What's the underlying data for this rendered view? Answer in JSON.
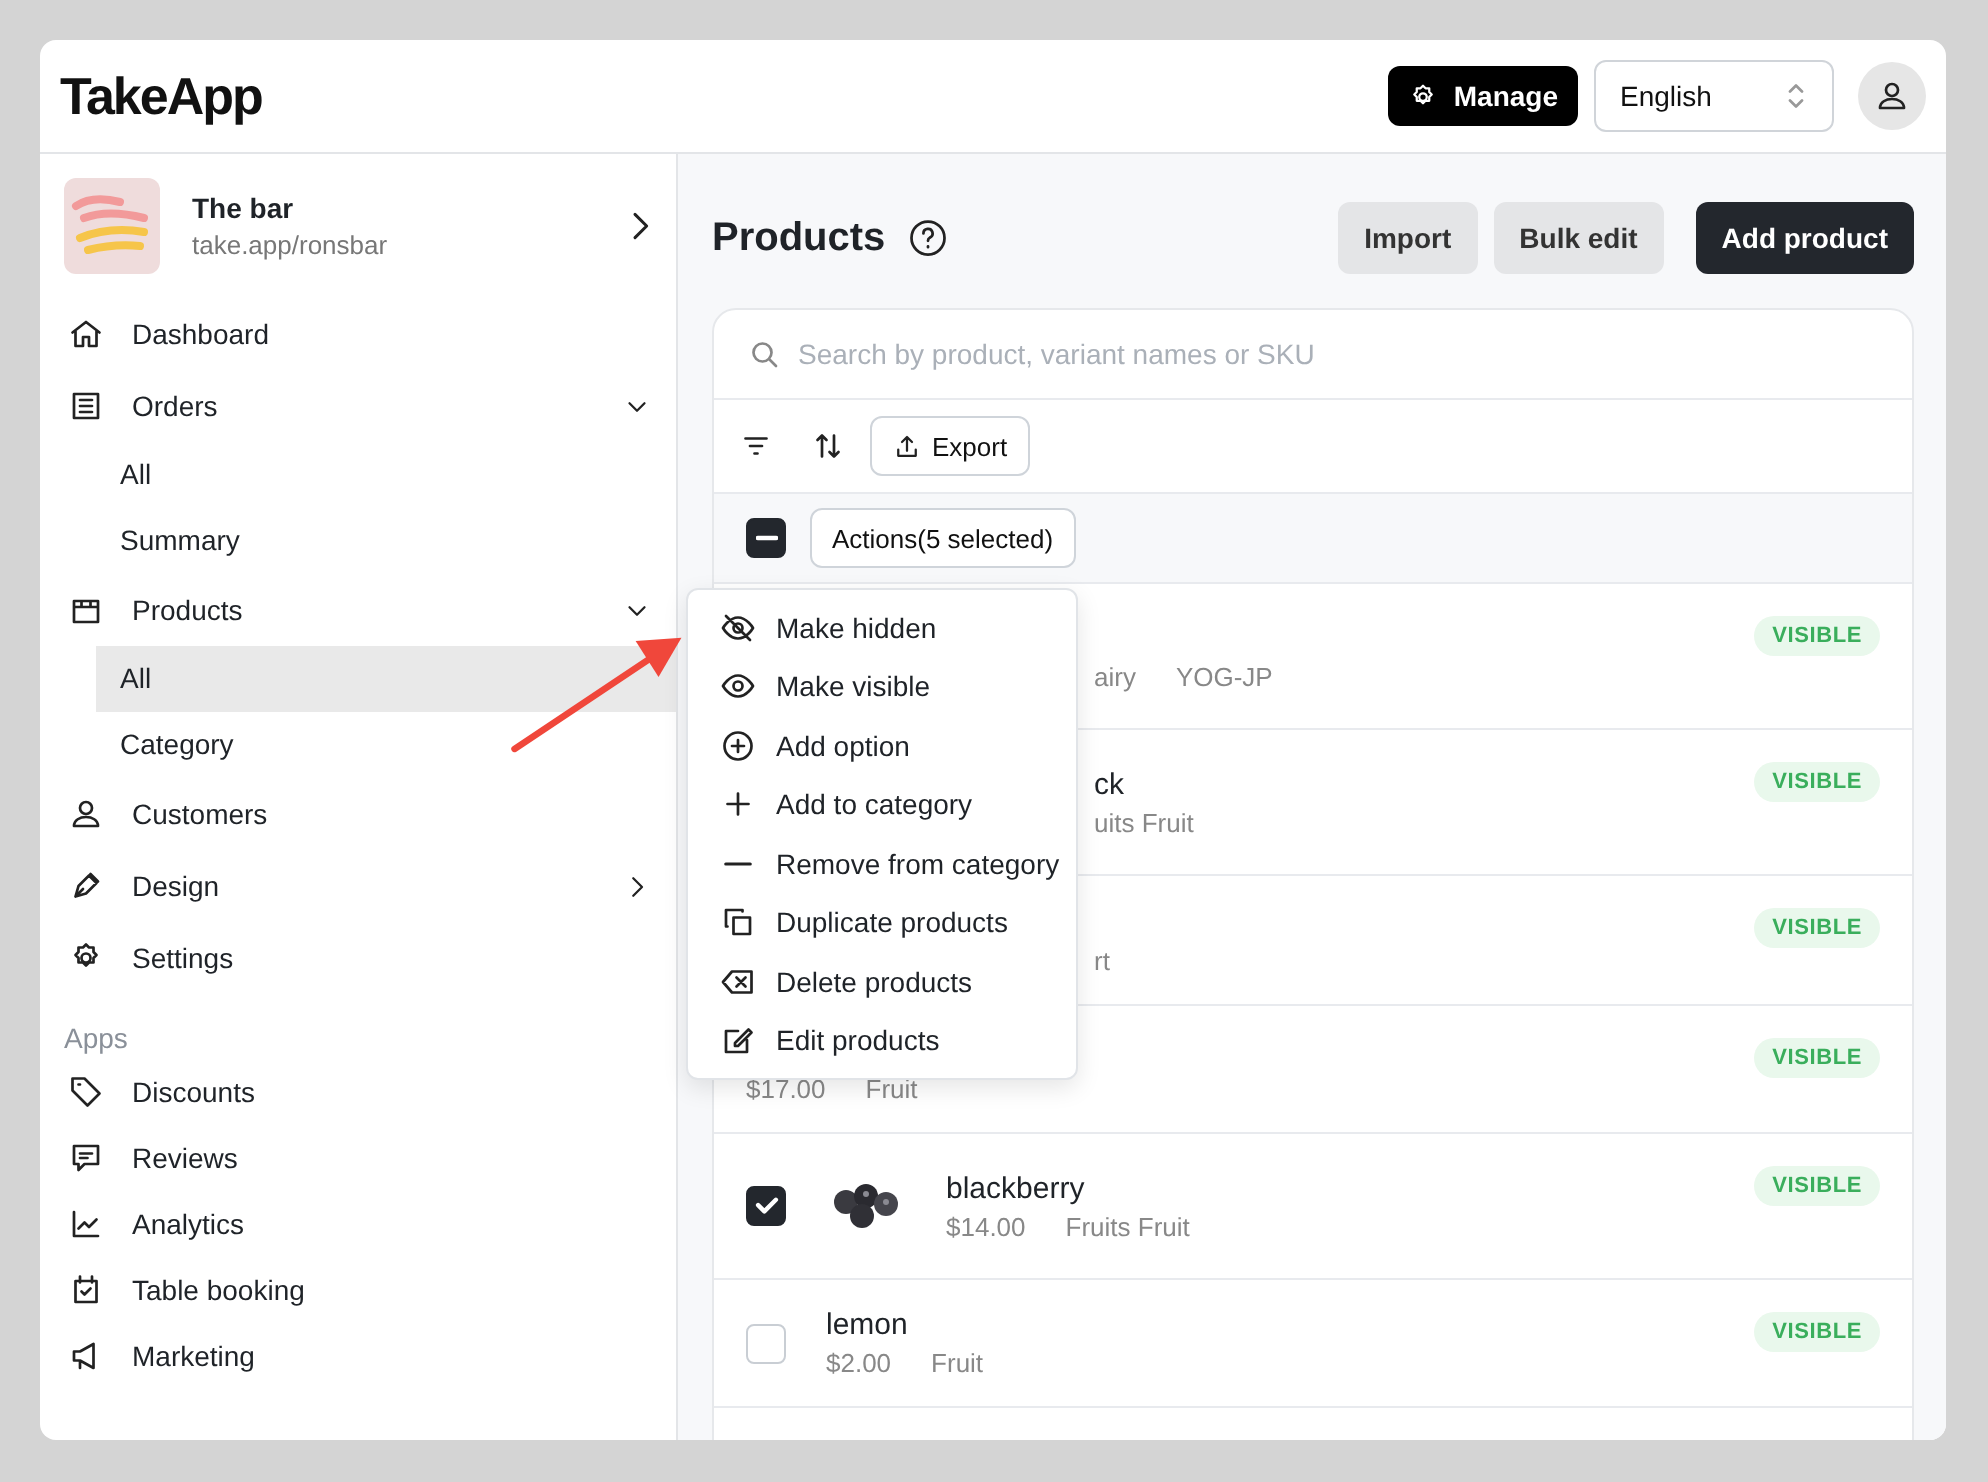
{
  "header": {
    "logo": "TakeApp",
    "manage_button": "Manage",
    "language": "English"
  },
  "store": {
    "name": "The bar",
    "url": "take.app/ronsbar"
  },
  "nav": [
    {
      "label": "Dashboard"
    },
    {
      "label": "Orders",
      "expanded": true,
      "children": [
        {
          "label": "All",
          "selected": false
        },
        {
          "label": "Summary",
          "selected": false
        }
      ]
    },
    {
      "label": "Products",
      "expanded": true,
      "children": [
        {
          "label": "All",
          "selected": true
        },
        {
          "label": "Category",
          "selected": false
        }
      ]
    },
    {
      "label": "Customers"
    },
    {
      "label": "Design",
      "expanded": false
    },
    {
      "label": "Settings"
    }
  ],
  "apps": {
    "heading": "Apps",
    "items": [
      {
        "label": "Discounts"
      },
      {
        "label": "Reviews"
      },
      {
        "label": "Analytics"
      },
      {
        "label": "Table booking"
      },
      {
        "label": "Marketing"
      }
    ]
  },
  "page": {
    "title": "Products",
    "buttons": [
      {
        "label": "Import",
        "kind": "secondary"
      },
      {
        "label": "Bulk edit",
        "kind": "secondary"
      },
      {
        "label": "Add product",
        "kind": "primary"
      }
    ]
  },
  "search": {
    "placeholder": "Search by product, variant names or SKU"
  },
  "toolbar": {
    "export": "Export"
  },
  "bulk": {
    "indeterminate": true,
    "actions": "Actions(5 selected)"
  },
  "rows": [
    {
      "kind": "covered",
      "meta": [
        "airy",
        "YOG-JP"
      ],
      "status": "VISIBLE"
    },
    {
      "kind": "covered",
      "name": "ck",
      "meta": [
        "uits Fruit"
      ],
      "status": "VISIBLE"
    },
    {
      "kind": "covered",
      "meta": [
        "rt"
      ],
      "status": "VISIBLE"
    },
    {
      "kind": "plain",
      "meta": [
        "$17.00",
        "Fruit"
      ],
      "status": "VISIBLE"
    },
    {
      "checked": true,
      "name": "blackberry",
      "meta": [
        "$14.00",
        "Fruits Fruit"
      ],
      "status": "VISIBLE"
    },
    {
      "kind": "plain",
      "checked": false,
      "name": "lemon",
      "meta": [
        "$2.00",
        "Fruit"
      ],
      "status": "VISIBLE"
    }
  ],
  "menu": [
    "Make hidden",
    "Make visible",
    "Add option",
    "Add to category",
    "Remove from category",
    "Duplicate products",
    "Delete products",
    "Edit products"
  ]
}
